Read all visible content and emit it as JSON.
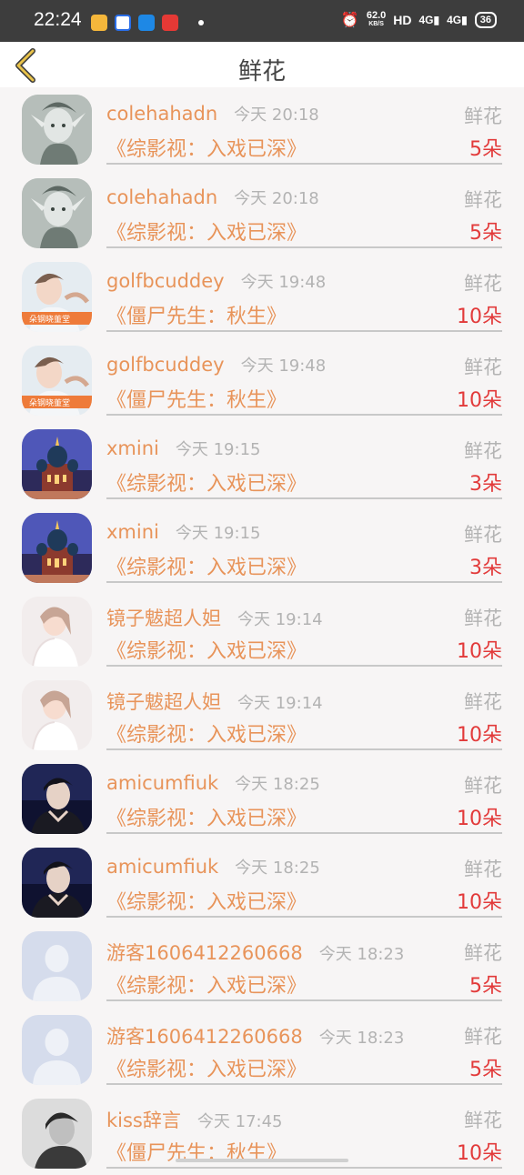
{
  "status_bar": {
    "time": "22:24",
    "net_speed": "62.0",
    "net_unit": "KB/S",
    "hd_label": "HD",
    "sig1": "4G",
    "sig2": "4G",
    "battery": "36",
    "app_icons": [
      "weibo-icon",
      "youku-icon",
      "video-app-icon",
      "red-app-icon"
    ]
  },
  "nav": {
    "title": "鲜花",
    "back_icon": "chevron-left-icon",
    "accent": "#e8c24a"
  },
  "colors": {
    "name": "#e8945a",
    "count": "#e23a3a",
    "muted": "#b3b3b3"
  },
  "items": [
    {
      "user": "colehahadn",
      "time": "今天 20:18",
      "type": "鲜花",
      "work": "《综影视：入戏已深》",
      "count": "5朵",
      "avatar": "elf-avatar"
    },
    {
      "user": "colehahadn",
      "time": "今天 20:18",
      "type": "鲜花",
      "work": "《综影视：入戏已深》",
      "count": "5朵",
      "avatar": "elf-avatar"
    },
    {
      "user": "golfbcuddey",
      "time": "今天 19:48",
      "type": "鲜花",
      "work": "《僵尸先生：秋生》",
      "count": "10朵",
      "avatar": "photo-avatar-banner"
    },
    {
      "user": "golfbcuddey",
      "time": "今天 19:48",
      "type": "鲜花",
      "work": "《僵尸先生：秋生》",
      "count": "10朵",
      "avatar": "photo-avatar-banner"
    },
    {
      "user": "xmini",
      "time": "今天 19:15",
      "type": "鲜花",
      "work": "《综影视：入戏已深》",
      "count": "3朵",
      "avatar": "cathedral-avatar"
    },
    {
      "user": "xmini",
      "time": "今天 19:15",
      "type": "鲜花",
      "work": "《综影视：入戏已深》",
      "count": "3朵",
      "avatar": "cathedral-avatar"
    },
    {
      "user": "镜子魃超人妲",
      "time": "今天 19:14",
      "type": "鲜花",
      "work": "《综影视：入戏已深》",
      "count": "10朵",
      "avatar": "girl-avatar"
    },
    {
      "user": "镜子魃超人妲",
      "time": "今天 19:14",
      "type": "鲜花",
      "work": "《综影视：入戏已深》",
      "count": "10朵",
      "avatar": "girl-avatar"
    },
    {
      "user": "amicumfiuk",
      "time": "今天 18:25",
      "type": "鲜花",
      "work": "《综影视：入戏已深》",
      "count": "10朵",
      "avatar": "dark-portrait-avatar"
    },
    {
      "user": "amicumfiuk",
      "time": "今天 18:25",
      "type": "鲜花",
      "work": "《综影视：入戏已深》",
      "count": "10朵",
      "avatar": "dark-portrait-avatar"
    },
    {
      "user": "游客1606412260668",
      "time": "今天 18:23",
      "type": "鲜花",
      "work": "《综影视：入戏已深》",
      "count": "5朵",
      "avatar": "default-user-avatar"
    },
    {
      "user": "游客1606412260668",
      "time": "今天 18:23",
      "type": "鲜花",
      "work": "《综影视：入戏已深》",
      "count": "5朵",
      "avatar": "default-user-avatar"
    },
    {
      "user": "kiss辞言",
      "time": "今天 17:45",
      "type": "鲜花",
      "work": "《僵尸先生：秋生》",
      "count": "10朵",
      "avatar": "bw-portrait-avatar"
    }
  ]
}
